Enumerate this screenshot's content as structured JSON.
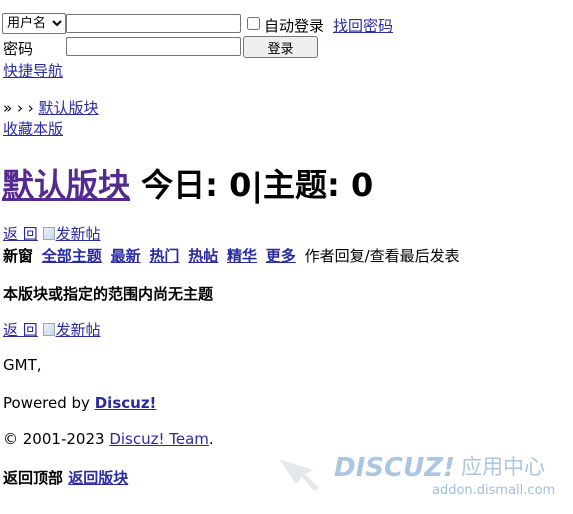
{
  "login": {
    "username_select": "用户名",
    "username_value": "",
    "auto_login_label": "自动登录",
    "forgot_password": "找回密码",
    "password_label": "密码",
    "password_value": "",
    "login_button": "登录"
  },
  "quick_nav": "快捷导航",
  "breadcrumb": {
    "prefix": "» › ›",
    "current": "默认版块"
  },
  "favorite_forum": "收藏本版",
  "forum_header": {
    "title": "默认版块",
    "stats": "今日: 0|主题: 0"
  },
  "top_tools": {
    "back": "返 回",
    "new_post": "发新帖"
  },
  "filter_bar": {
    "new_window": "新窗",
    "links": [
      "全部主题",
      "最新",
      "热门",
      "热帖",
      "精华",
      "更多"
    ],
    "author_text": "作者",
    "reply_view": "回复/查看",
    "last_post": "最后发表"
  },
  "empty_message": "本版块或指定的范围内尚无主题",
  "bottom_tools": {
    "back": "返 回",
    "new_post": "发新帖"
  },
  "footer": {
    "gmt": "GMT,",
    "powered_by": "Powered by",
    "powered_link": "Discuz!",
    "copyright_prefix": "© 2001-2023",
    "copyright_link": "Discuz! Team",
    "copyright_suffix": ".",
    "back_to_top": "返回顶部",
    "back_to_forum": "返回版块"
  },
  "watermark": {
    "brand": "DISCUZ!",
    "brand_cn": "应用中心",
    "domain": "addon.dismall.com"
  }
}
